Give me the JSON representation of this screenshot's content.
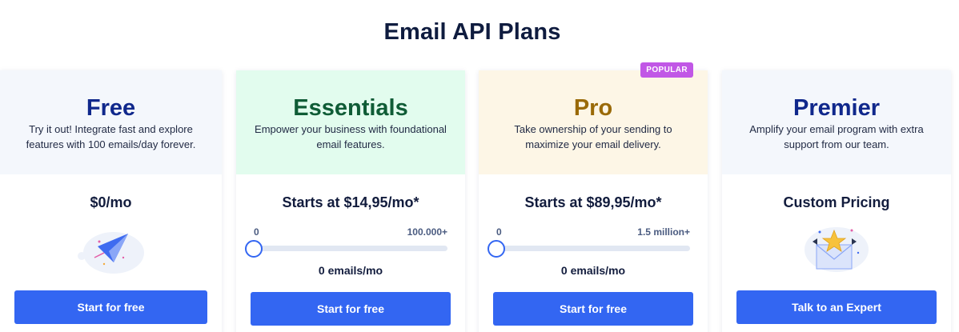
{
  "header": {
    "title": "Email API Plans"
  },
  "colors": {
    "accent": "#3366f2",
    "free_top": "#f4f7fc",
    "essentials_top": "#e2fcee",
    "pro_top": "#fdf6e6",
    "premier_top": "#f4f7fc",
    "free_name": "#10288c",
    "essentials_name": "#0f5c36",
    "pro_name": "#9a6a08",
    "premier_name": "#10288c",
    "badge": "#c157e6"
  },
  "plans": [
    {
      "name": "Free",
      "description": "Try it out! Integrate fast and explore features with 100 emails/day forever.",
      "price": "$0/mo",
      "illustration": "paper-plane-icon",
      "button": "Start for free"
    },
    {
      "name": "Essentials",
      "description": "Empower your business with foundational email features.",
      "price": "Starts at $14,95/mo*",
      "slider": {
        "min_label": "0",
        "max_label": "100.000+",
        "value": 0
      },
      "emails_label": "0 emails/mo",
      "button": "Start for free"
    },
    {
      "name": "Pro",
      "badge": "POPULAR",
      "description": "Take ownership of your sending to maximize your email delivery.",
      "price": "Starts at $89,95/mo*",
      "slider": {
        "min_label": "0",
        "max_label": "1.5 million+",
        "value": 0
      },
      "emails_label": "0 emails/mo",
      "button": "Start for free"
    },
    {
      "name": "Premier",
      "description": "Amplify your email program with extra support from our team.",
      "price": "Custom Pricing",
      "illustration": "star-envelope-icon",
      "button": "Talk to an Expert"
    }
  ]
}
